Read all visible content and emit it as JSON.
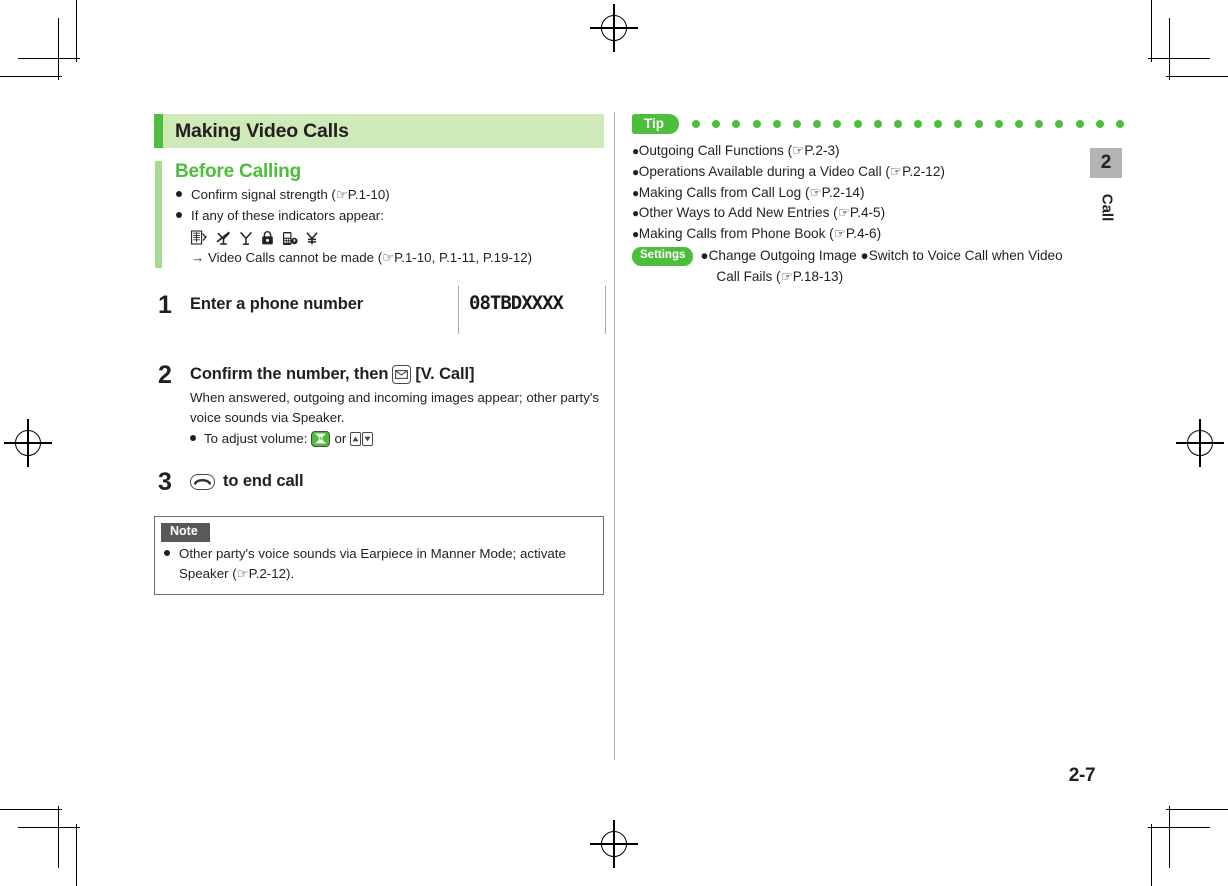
{
  "document": {
    "page_number": "2-7",
    "chapter_tab": {
      "number": "2",
      "label": "Call"
    }
  },
  "left_column": {
    "title": "Making Video Calls",
    "before_calling": {
      "heading": "Before Calling",
      "bullets": [
        "Confirm signal strength (☞P.1-10)",
        "If any of these indicators appear:"
      ],
      "indicator_icons": [
        "out-of-service-area-icon",
        "no-signal-icon",
        "antenna-icon",
        "lock-icon",
        "phone-lock-icon",
        "yen-icon"
      ],
      "result_line": "→ Video Calls cannot be made (☞P.1-10, P.1-11, P.19-12)"
    },
    "steps": [
      {
        "number": "1",
        "heading": "Enter a phone number",
        "screen_value": "08TBDXXXX"
      },
      {
        "number": "2",
        "heading_prefix": "Confirm the number, then",
        "heading_key": "mail-key-icon",
        "heading_suffix": "[V. Call]",
        "body": "When answered, outgoing and incoming images appear; other party's voice sounds via Speaker.",
        "sub_prefix": "To adjust volume:",
        "sub_mid": "or"
      },
      {
        "number": "3",
        "heading_key": "end-call-key-icon",
        "heading_suffix": "to end call"
      }
    ],
    "note": {
      "tag": "Note",
      "text": "Other party's voice sounds via Earpiece in Manner Mode; activate Speaker (☞P.2-12)."
    }
  },
  "right_column": {
    "tip": {
      "badge": "Tip",
      "dot_count": 22,
      "items": [
        "Outgoing Call Functions (☞P.2-3)",
        "Operations Available during a Video Call (☞P.2-12)",
        "Making Calls from Call Log (☞P.2-14)",
        "Other Ways to Add New Entries (☞P.4-5)",
        "Making Calls from Phone Book (☞P.4-6)"
      ],
      "settings": {
        "badge": "Settings",
        "line1": "●Change Outgoing Image ●Switch to Voice Call when Video",
        "line2": "Call Fails (☞P.18-13)"
      }
    }
  },
  "colors": {
    "brand_green": "#4cbe3b",
    "title_band": "#cfe9b9",
    "section_bar": "#a7da92",
    "note_tag": "#595959",
    "chapter_tab": "#b3b3b3"
  }
}
